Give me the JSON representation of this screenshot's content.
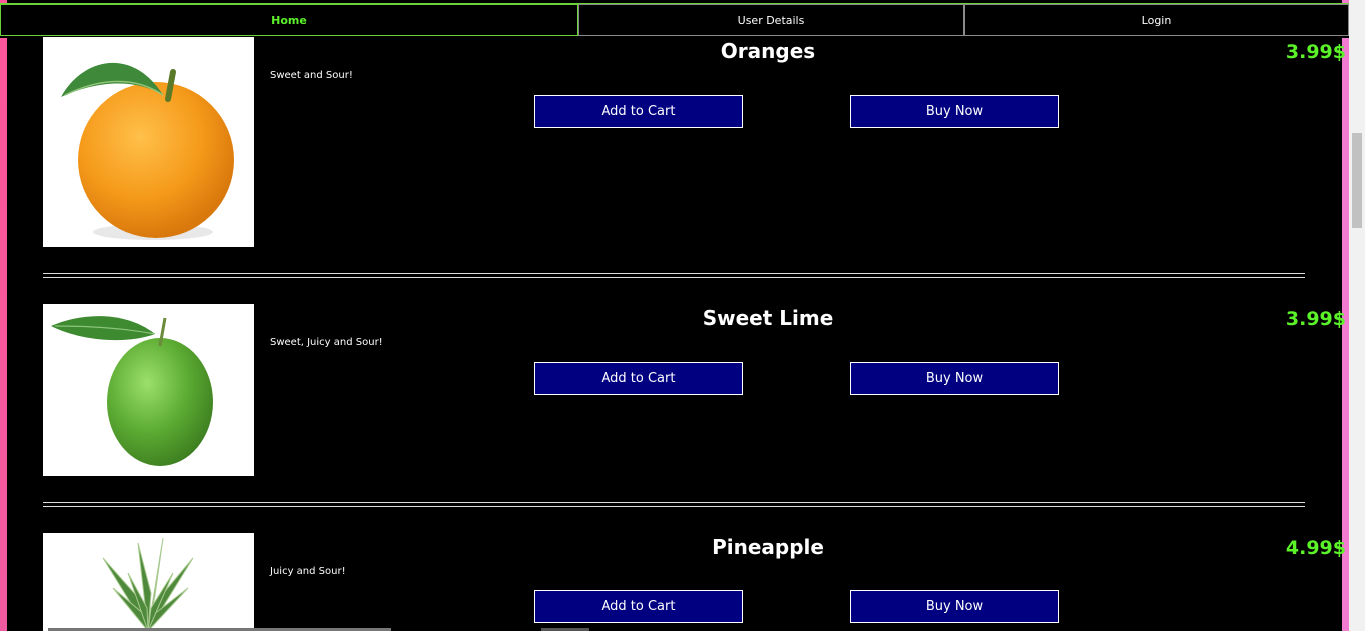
{
  "nav": {
    "items": [
      {
        "label": "Home",
        "active": true
      },
      {
        "label": "User Details",
        "active": false
      },
      {
        "label": "Login",
        "active": false
      }
    ]
  },
  "products": [
    {
      "name": "Oranges",
      "description": "Sweet and Sour!",
      "price": "3.99$",
      "add_label": "Add to Cart",
      "buy_label": "Buy Now"
    },
    {
      "name": "Sweet Lime",
      "description": "Sweet, Juicy and Sour!",
      "price": "3.99$",
      "add_label": "Add to Cart",
      "buy_label": "Buy Now"
    },
    {
      "name": "Pineapple",
      "description": "Juicy and Sour!",
      "price": "4.99$",
      "add_label": "Add to Cart",
      "buy_label": "Buy Now"
    }
  ],
  "colors": {
    "accent_green": "#5cf22a",
    "button_bg": "#000080",
    "background": "#000000"
  }
}
